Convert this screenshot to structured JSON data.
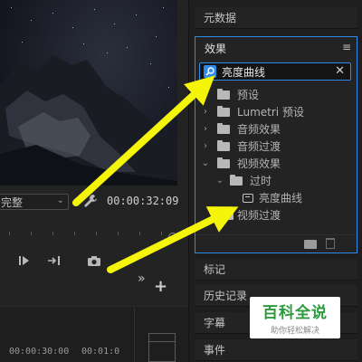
{
  "monitor": {
    "fit_value": "完整",
    "timecode": "00:00:32:09",
    "sequence": {
      "timecode_a": "00:00:30:00",
      "timecode_b": "00:01:0"
    }
  },
  "panels": {
    "metadata": "元数据",
    "markers": "标记",
    "history": "历史记录",
    "captions": "字幕",
    "events": "事件"
  },
  "effects": {
    "title": "效果",
    "search_value": "亮度曲线",
    "items": [
      {
        "label": "预设"
      },
      {
        "label": "Lumetri 预设"
      },
      {
        "label": "音频效果"
      },
      {
        "label": "音频过渡"
      },
      {
        "label": "视频效果"
      },
      {
        "label": "过时"
      },
      {
        "label": "亮度曲线"
      },
      {
        "label": "视频过渡"
      }
    ]
  },
  "icons": {
    "search": "search-icon",
    "clear": "close-icon",
    "menu": "hamburger-menu-icon",
    "folder": "folder-icon",
    "effect": "effect-icon",
    "wrench": "wrench-icon",
    "camera": "camera-icon",
    "trash": "trash-icon"
  },
  "colors": {
    "accent": "#2d8ceb",
    "arrow": "#f5f50a",
    "watermark_green": "#2a9b3d"
  },
  "watermark": {
    "title": "百科全说",
    "subtitle": "助你轻松解决"
  }
}
